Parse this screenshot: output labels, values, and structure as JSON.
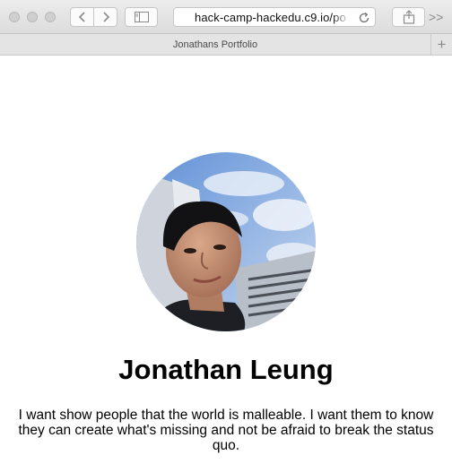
{
  "browser": {
    "address_url": "hack-camp-hackedu.c9.io/po",
    "tab_title": "Jonathans Portfolio",
    "new_tab_label": "+",
    "overflow_label": ">>",
    "icons": {
      "back": "chevron-left-icon",
      "forward": "chevron-right-icon",
      "sidebar": "sidebar-icon",
      "reload": "reload-icon",
      "share": "share-icon"
    }
  },
  "profile": {
    "name": "Jonathan Leung",
    "bio": "I want show people that the world is malleable. I want them to know they can create what's missing and not be afraid to break the status quo.",
    "photo": "profile-photo"
  },
  "colors": {
    "sky": "#8fb1e3",
    "text": "#000000",
    "chrome": "#e4e4e4"
  }
}
